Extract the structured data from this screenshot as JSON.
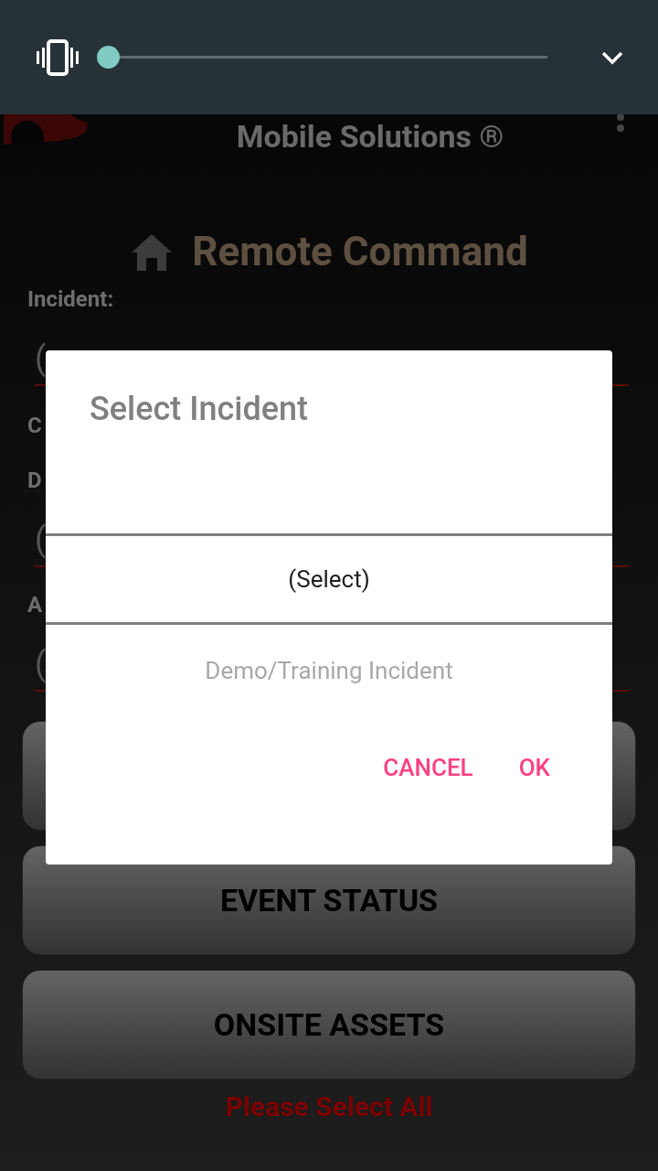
{
  "volume_panel": {
    "level": 0
  },
  "header": {
    "title": "Mobile Solutions ®"
  },
  "page_title": "Remote Command",
  "form": [
    {
      "kind": "label",
      "text": "Incident:"
    },
    {
      "kind": "field",
      "value": "("
    },
    {
      "kind": "label",
      "text": "C"
    },
    {
      "kind": "label",
      "text": "D"
    },
    {
      "kind": "field",
      "value": "("
    },
    {
      "kind": "label",
      "text": "A"
    },
    {
      "kind": "field",
      "value": "("
    }
  ],
  "menu_buttons": [
    {
      "kind": "covered"
    },
    {
      "kind": "labeled",
      "label": "EVENT STATUS"
    },
    {
      "kind": "labeled",
      "label": "ONSITE ASSETS"
    }
  ],
  "footer_message": "Please Select All",
  "dialog": {
    "title": "Select Incident",
    "options": [
      {
        "label": "(Select)",
        "selected": true
      },
      {
        "label": "Demo/Training Incident",
        "selected": false
      }
    ],
    "buttons": [
      "CANCEL",
      "OK"
    ]
  }
}
